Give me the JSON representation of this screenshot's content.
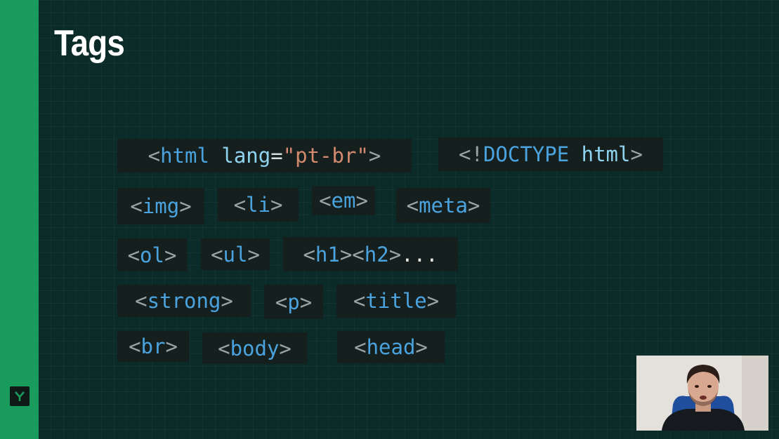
{
  "slide": {
    "title": "Tags",
    "logo_letter": "Y"
  },
  "tags": {
    "html_lang": {
      "open": "<",
      "name": "html",
      "attr": "lang",
      "eq": "=",
      "value": "\"pt-br\"",
      "close": ">"
    },
    "doctype": {
      "open": "<!",
      "name": "DOCTYPE",
      "attr": "html",
      "close": ">"
    },
    "img": {
      "open": "<",
      "name": "img",
      "close": ">"
    },
    "li": {
      "open": "<",
      "name": "li",
      "close": ">"
    },
    "em": {
      "open": "<",
      "name": "em",
      "close": ">"
    },
    "meta": {
      "open": "<",
      "name": "meta",
      "close": ">"
    },
    "ol": {
      "open": "<",
      "name": "ol",
      "close": ">"
    },
    "ul": {
      "open": "<",
      "name": "ul",
      "close": ">"
    },
    "headings": {
      "open": "<",
      "name1": "h1",
      "mid": "><",
      "name2": "h2",
      "close": ">",
      "ellipsis": "..."
    },
    "strong": {
      "open": "<",
      "name": "strong",
      "close": ">"
    },
    "p": {
      "open": "<",
      "name": "p",
      "close": ">"
    },
    "title": {
      "open": "<",
      "name": "title",
      "close": ">"
    },
    "br": {
      "open": "<",
      "name": "br",
      "close": ">"
    },
    "body": {
      "open": "<",
      "name": "body",
      "close": ">"
    },
    "head": {
      "open": "<",
      "name": "head",
      "close": ">"
    }
  },
  "colors": {
    "background": "#0b2b28",
    "sidebar": "#1a9b5e",
    "tag_name": "#4aa3df",
    "bracket": "#9aa4a8",
    "string": "#d48a6e"
  },
  "icons": [
    "logo-y-icon"
  ]
}
